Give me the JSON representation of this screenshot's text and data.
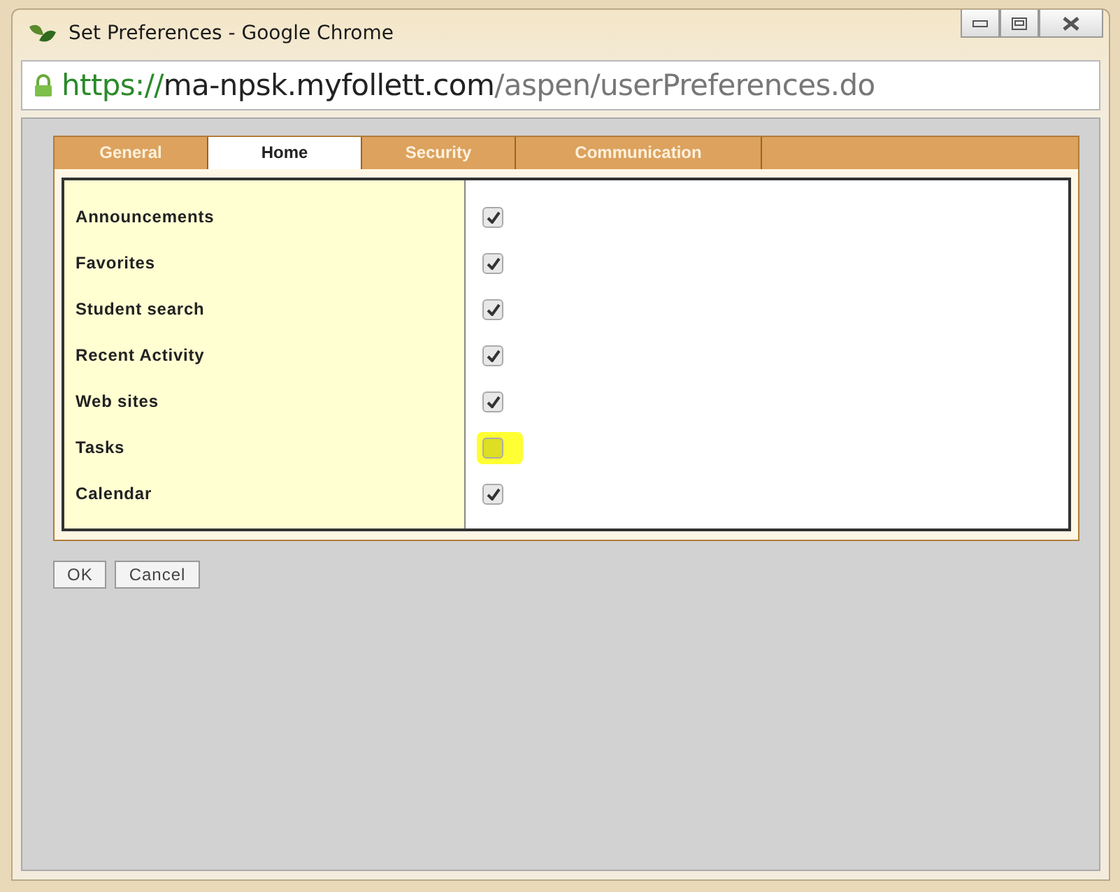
{
  "window": {
    "title": "Set Preferences - Google Chrome"
  },
  "address": {
    "scheme": "https://",
    "host": "ma-npsk.myfollett.com",
    "path": "/aspen/userPreferences.do"
  },
  "tabs": [
    {
      "label": "General",
      "selected": false
    },
    {
      "label": "Home",
      "selected": true
    },
    {
      "label": "Security",
      "selected": false
    },
    {
      "label": "Communication",
      "selected": false
    }
  ],
  "options": [
    {
      "label": "Announcements",
      "checked": true,
      "highlighted": false
    },
    {
      "label": "Favorites",
      "checked": true,
      "highlighted": false
    },
    {
      "label": "Student search",
      "checked": true,
      "highlighted": false
    },
    {
      "label": "Recent Activity",
      "checked": true,
      "highlighted": false
    },
    {
      "label": "Web sites",
      "checked": true,
      "highlighted": false
    },
    {
      "label": "Tasks",
      "checked": false,
      "highlighted": true
    },
    {
      "label": "Calendar",
      "checked": true,
      "highlighted": false
    }
  ],
  "buttons": [
    "OK",
    "Cancel"
  ]
}
